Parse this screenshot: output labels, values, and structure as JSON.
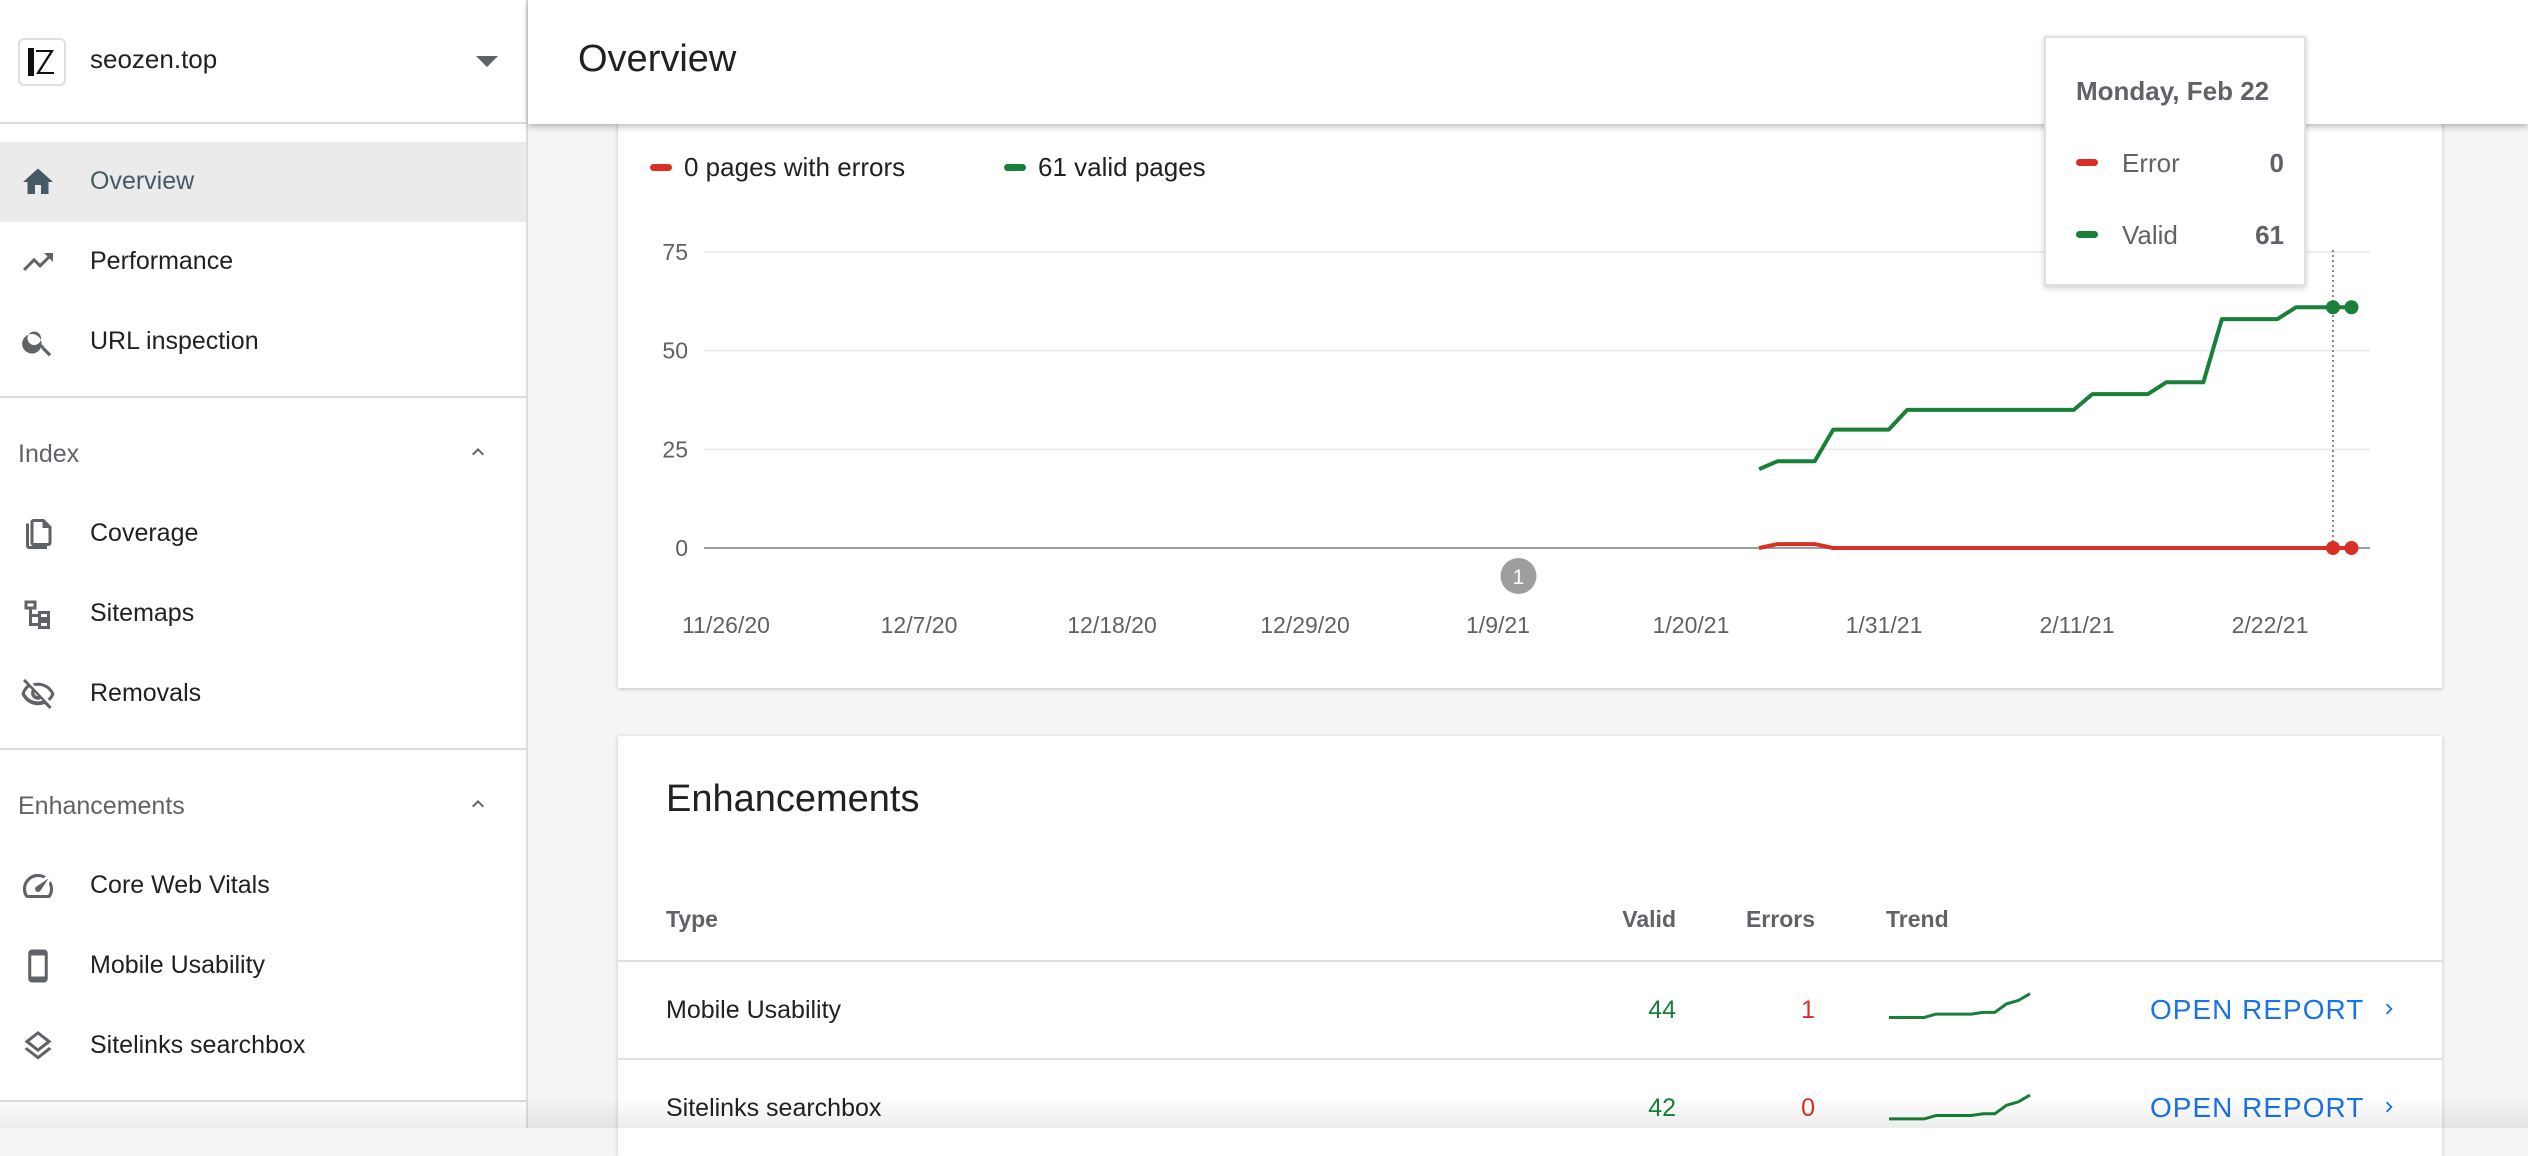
{
  "property": {
    "name": "seozen.top"
  },
  "sidebar": {
    "items": [
      {
        "label": "Overview",
        "icon": "home-icon"
      },
      {
        "label": "Performance",
        "icon": "trending-up-icon"
      },
      {
        "label": "URL inspection",
        "icon": "search-icon"
      }
    ],
    "sections": [
      {
        "title": "Index",
        "items": [
          {
            "label": "Coverage",
            "icon": "copy-icon"
          },
          {
            "label": "Sitemaps",
            "icon": "sitemap-icon"
          },
          {
            "label": "Removals",
            "icon": "eye-off-icon"
          }
        ]
      },
      {
        "title": "Enhancements",
        "items": [
          {
            "label": "Core Web Vitals",
            "icon": "speedometer-icon"
          },
          {
            "label": "Mobile Usability",
            "icon": "phone-icon"
          },
          {
            "label": "Sitelinks searchbox",
            "icon": "layers-icon"
          }
        ]
      }
    ]
  },
  "header": {
    "title": "Overview"
  },
  "coverage": {
    "legend_errors": "0 pages with errors",
    "legend_valid": "61 valid pages"
  },
  "tooltip": {
    "date": "Monday, Feb 22",
    "rows": [
      {
        "label": "Error",
        "value": "0"
      },
      {
        "label": "Valid",
        "value": "61"
      }
    ]
  },
  "colors": {
    "error": "#d93025",
    "valid": "#188038",
    "accent": "#1a73e8"
  },
  "chart_data": {
    "type": "line",
    "x_ticks": [
      "11/26/20",
      "12/7/20",
      "12/18/20",
      "12/29/20",
      "1/9/21",
      "1/20/21",
      "1/31/21",
      "2/11/21",
      "2/22/21"
    ],
    "y_ticks": [
      "75",
      "50",
      "25",
      "0"
    ],
    "ylim": [
      0,
      75
    ],
    "xlim": [
      "2020-11-26",
      "2021-02-24"
    ],
    "annotation": {
      "date": "2021-01-09",
      "label": "1"
    },
    "series": [
      {
        "key": "valid",
        "color": "#188038",
        "points": [
          [
            "2021-01-22",
            20
          ],
          [
            "2021-01-23",
            22
          ],
          [
            "2021-01-25",
            22
          ],
          [
            "2021-01-26",
            30
          ],
          [
            "2021-01-29",
            30
          ],
          [
            "2021-01-30",
            35
          ],
          [
            "2021-02-08",
            35
          ],
          [
            "2021-02-09",
            39
          ],
          [
            "2021-02-12",
            39
          ],
          [
            "2021-02-13",
            42
          ],
          [
            "2021-02-15",
            42
          ],
          [
            "2021-02-16",
            58
          ],
          [
            "2021-02-19",
            58
          ],
          [
            "2021-02-20",
            61
          ],
          [
            "2021-02-22",
            61
          ],
          [
            "2021-02-23",
            61
          ]
        ]
      },
      {
        "key": "error",
        "color": "#d93025",
        "points": [
          [
            "2021-01-22",
            0
          ],
          [
            "2021-01-23",
            1
          ],
          [
            "2021-01-25",
            1
          ],
          [
            "2021-01-26",
            0
          ],
          [
            "2021-02-22",
            0
          ],
          [
            "2021-02-23",
            0
          ]
        ]
      }
    ],
    "hover": {
      "date": "2021-02-22"
    }
  },
  "enhancements": {
    "title": "Enhancements",
    "headers": {
      "type": "Type",
      "valid": "Valid",
      "errors": "Errors",
      "trend": "Trend"
    },
    "rows": [
      {
        "type": "Mobile Usability",
        "valid": "44",
        "errors": "1",
        "action": "OPEN REPORT",
        "trend": [
          30,
          30,
          30,
          30,
          32,
          32,
          32,
          32,
          33,
          33,
          38,
          40,
          44
        ]
      },
      {
        "type": "Sitelinks searchbox",
        "valid": "42",
        "errors": "0",
        "action": "OPEN REPORT",
        "trend": [
          28,
          28,
          28,
          28,
          30,
          30,
          30,
          30,
          31,
          31,
          36,
          38,
          42
        ]
      }
    ]
  }
}
